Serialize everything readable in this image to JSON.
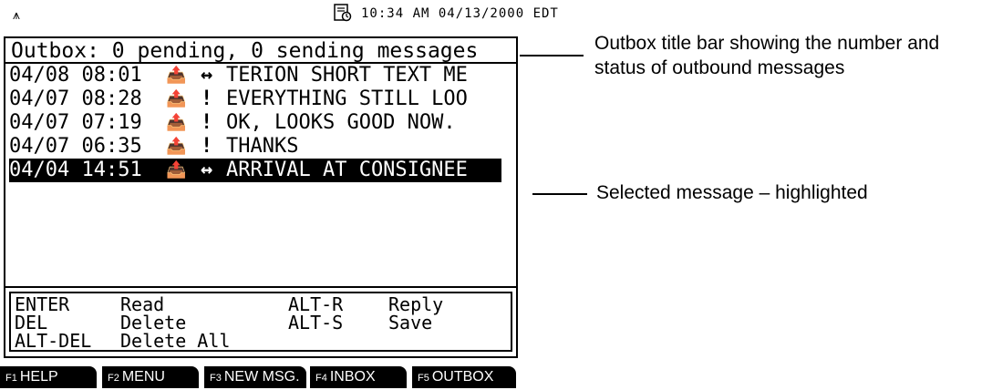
{
  "status_bar": {
    "antenna_glyph": "⩚",
    "clock": "10:34 AM 04/13/2000 EDT"
  },
  "outbox": {
    "title": "Outbox: 0 pending, 0 sending messages",
    "messages": [
      {
        "time": "04/08 08:01",
        "icon": "outbox-envelope-icon",
        "status": "↔",
        "text": "TERION SHORT TEXT ME"
      },
      {
        "time": "04/07 08:28",
        "icon": "outbox-envelope-icon",
        "status": "!",
        "text": "EVERYTHING STILL LOO"
      },
      {
        "time": "04/07 07:19",
        "icon": "outbox-envelope-icon",
        "status": "!",
        "text": "OK, LOOKS GOOD NOW."
      },
      {
        "time": "04/07 06:35",
        "icon": "outbox-envelope-icon",
        "status": "!",
        "text": "THANKS"
      },
      {
        "time": "04/04 14:51",
        "icon": "outbox-envelope-icon",
        "status": "↔",
        "text": "ARRIVAL AT CONSIGNEE",
        "selected": true
      }
    ]
  },
  "help": {
    "rows": [
      {
        "key1": "ENTER",
        "action1": "Read",
        "key2": "ALT-R",
        "action2": "Reply"
      },
      {
        "key1": "DEL",
        "action1": "Delete",
        "key2": "ALT-S",
        "action2": "Save"
      },
      {
        "key1": "ALT-DEL",
        "action1": "Delete All",
        "key2": "",
        "action2": ""
      }
    ]
  },
  "function_keys": [
    {
      "num": "F1",
      "label": "HELP"
    },
    {
      "num": "F2",
      "label": "MENU"
    },
    {
      "num": "F3",
      "label": "NEW MSG."
    },
    {
      "num": "F4",
      "label": "INBOX"
    },
    {
      "num": "F5",
      "label": "OUTBOX"
    }
  ],
  "callouts": {
    "title_bar": "Outbox title bar showing the number and status of outbound messages",
    "selected": "Selected message – highlighted"
  }
}
